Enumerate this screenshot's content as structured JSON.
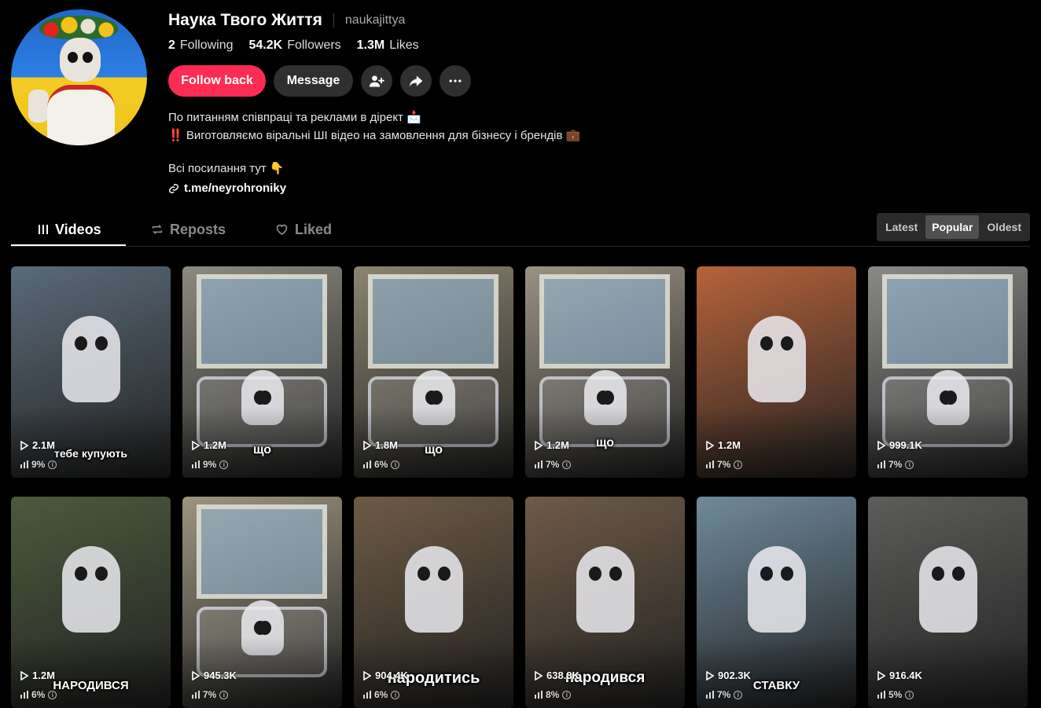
{
  "profile": {
    "name": "Наука Твого Життя",
    "handle": "naukajittya",
    "stats": [
      {
        "value": "2",
        "label": "Following"
      },
      {
        "value": "54.2K",
        "label": "Followers"
      },
      {
        "value": "1.3M",
        "label": "Likes"
      }
    ],
    "follow_back_label": "Follow back",
    "message_label": "Message",
    "bio_line1": "По питанням співпраці та реклами в дірект 📩",
    "bio_line2": "‼️ Виготовляємо віральні ШІ відео на замовлення для бізнесу і брендів 💼",
    "bio_line3": "Всі посилання тут 👇",
    "link": "t.me/neyrohroniky"
  },
  "tabs": [
    {
      "label": "Videos",
      "icon": "grid-icon"
    },
    {
      "label": "Reposts",
      "icon": "repost-icon"
    },
    {
      "label": "Liked",
      "icon": "heart-icon"
    }
  ],
  "sort": [
    "Latest",
    "Popular",
    "Oldest"
  ],
  "videos": [
    {
      "views": "2.1M",
      "pct": "9%",
      "caption": "тебе купують",
      "bg": "#5a6a78"
    },
    {
      "views": "1.2M",
      "pct": "9%",
      "caption": "що",
      "bg": "#8d8a80"
    },
    {
      "views": "1.8M",
      "pct": "6%",
      "caption": "що",
      "bg": "#8c8470"
    },
    {
      "views": "1.2M",
      "pct": "7%",
      "caption": "що",
      "bg": "#9a9284"
    },
    {
      "views": "1.2M",
      "pct": "7%",
      "caption": "",
      "bg": "#b5633a"
    },
    {
      "views": "999.1K",
      "pct": "7%",
      "caption": "",
      "bg": "#8a8a86"
    },
    {
      "views": "1.2M",
      "pct": "6%",
      "caption": "НАРОДИВСЯ",
      "bg": "#4c5a3c"
    },
    {
      "views": "945.3K",
      "pct": "7%",
      "caption": "",
      "bg": "#9d9580"
    },
    {
      "views": "904.4K",
      "pct": "6%",
      "caption": "народитись",
      "bg": "#6d5a44"
    },
    {
      "views": "638.8K",
      "pct": "8%",
      "caption": "народився",
      "bg": "#6e5a46"
    },
    {
      "views": "902.3K",
      "pct": "7%",
      "caption": "СТАВКУ",
      "bg": "#6f8a9c"
    },
    {
      "views": "916.4K",
      "pct": "5%",
      "caption": "",
      "bg": "#5c5c5a"
    }
  ]
}
